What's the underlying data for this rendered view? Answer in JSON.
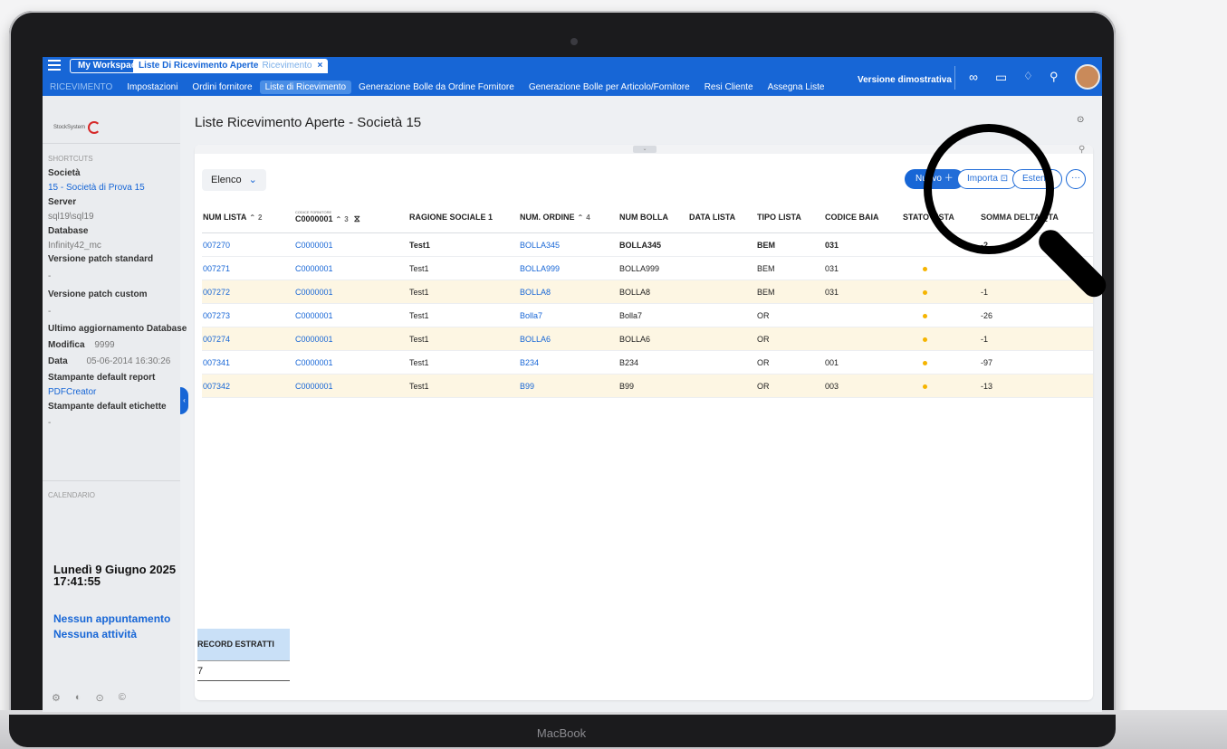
{
  "device": {
    "brand": "MacBook"
  },
  "topbar": {
    "workspace_label": "My Workspace",
    "open_tab": {
      "label": "Liste Di Ricevimento Aperte",
      "sub": "Ricevimento",
      "close": "×"
    },
    "nav": [
      {
        "label": "RICEVIMENTO",
        "state": "muted"
      },
      {
        "label": "Impostazioni",
        "state": "normal"
      },
      {
        "label": "Ordini fornitore",
        "state": "normal"
      },
      {
        "label": "Liste di Ricevimento",
        "state": "active"
      },
      {
        "label": "Generazione Bolle da Ordine Fornitore",
        "state": "normal"
      },
      {
        "label": "Generazione Bolle per Articolo/Fornitore",
        "state": "normal"
      },
      {
        "label": "Resi Cliente",
        "state": "normal"
      },
      {
        "label": "Assegna Liste",
        "state": "normal"
      }
    ],
    "version_label": "Versione dimostrativa",
    "icons": [
      "infinity-icon",
      "monitor-icon",
      "bell-icon",
      "search-icon",
      "user-avatar"
    ]
  },
  "sidebar": {
    "logo_text": "StockSystem",
    "shortcuts_title": "SHORTCUTS",
    "societa_label": "Società",
    "societa_value": "15 - Società di Prova 15",
    "server_label": "Server",
    "server_value": "sql19\\sql19",
    "database_label": "Database",
    "database_value": "Infinity42_mc",
    "patch_std_label": "Versione patch standard",
    "patch_std_value": "-",
    "patch_custom_label": "Versione patch custom",
    "patch_custom_value": "-",
    "last_update_label": "Ultimo aggiornamento Database",
    "modifica_label": "Modifica",
    "modifica_value": "9999",
    "data_label": "Data",
    "data_value": "05-06-2014 16:30:26",
    "printer_report_label": "Stampante default report",
    "printer_report_value": "PDFCreator",
    "printer_label_label": "Stampante default etichette",
    "printer_label_value": "-",
    "calendar_title": "CALENDARIO",
    "calendar_date": "Lunedì 9 Giugno 2025",
    "calendar_time": "17:41:55",
    "no_appointments": "Nessun appuntamento",
    "no_activities": "Nessuna attività"
  },
  "main": {
    "title": "Liste Ricevimento Aperte - Società 15",
    "help_icon": "?",
    "view_select": "Elenco",
    "btn_new": "Nuovo",
    "btn_import": "Importa",
    "btn_extend": "Estendi",
    "btn_more": "···",
    "columns": {
      "num_lista": "NUM LISTA",
      "num_lista_sort": "2",
      "codice_fornitore_small": "CODICE FORNITORE",
      "codice_fornitore_filter": "C0000001",
      "codice_fornitore_sort": "3",
      "ragione_sociale": "RAGIONE SOCIALE 1",
      "num_ordine": "NUM. ORDINE",
      "num_ordine_sort": "4",
      "num_bolla": "NUM BOLLA",
      "data_lista": "DATA LISTA",
      "tipo_lista": "TIPO LISTA",
      "codice_baia": "CODICE BAIA",
      "stato_lista": "STATO LISTA",
      "somma_delta": "SOMMA DELTA QTA"
    },
    "rows": [
      {
        "num_lista": "007270",
        "fornitore": "C0000001",
        "ragione": "Test1",
        "ordine": "BOLLA345",
        "bolla": "BOLLA345",
        "data": "",
        "tipo": "BEM",
        "baia": "031",
        "stato": "",
        "delta": "-2",
        "bold": true,
        "stripe": false
      },
      {
        "num_lista": "007271",
        "fornitore": "C0000001",
        "ragione": "Test1",
        "ordine": "BOLLA999",
        "bolla": "BOLLA999",
        "data": "",
        "tipo": "BEM",
        "baia": "031",
        "stato": "dot",
        "delta": "",
        "bold": false,
        "stripe": false
      },
      {
        "num_lista": "007272",
        "fornitore": "C0000001",
        "ragione": "Test1",
        "ordine": "BOLLA8",
        "bolla": "BOLLA8",
        "data": "",
        "tipo": "BEM",
        "baia": "031",
        "stato": "dot",
        "delta": "-1",
        "bold": false,
        "stripe": true
      },
      {
        "num_lista": "007273",
        "fornitore": "C0000001",
        "ragione": "Test1",
        "ordine": "Bolla7",
        "bolla": "Bolla7",
        "data": "",
        "tipo": "OR",
        "baia": "",
        "stato": "dot",
        "delta": "-26",
        "bold": false,
        "stripe": false
      },
      {
        "num_lista": "007274",
        "fornitore": "C0000001",
        "ragione": "Test1",
        "ordine": "BOLLA6",
        "bolla": "BOLLA6",
        "data": "",
        "tipo": "OR",
        "baia": "",
        "stato": "dot",
        "delta": "-1",
        "bold": false,
        "stripe": true
      },
      {
        "num_lista": "007341",
        "fornitore": "C0000001",
        "ragione": "Test1",
        "ordine": "B234",
        "bolla": "B234",
        "data": "",
        "tipo": "OR",
        "baia": "001",
        "stato": "dot",
        "delta": "-97",
        "bold": false,
        "stripe": false
      },
      {
        "num_lista": "007342",
        "fornitore": "C0000001",
        "ragione": "Test1",
        "ordine": "B99",
        "bolla": "B99",
        "data": "",
        "tipo": "OR",
        "baia": "003",
        "stato": "dot",
        "delta": "-13",
        "bold": false,
        "stripe": true
      }
    ],
    "record_label": "RECORD ESTRATTI",
    "record_value": "7"
  },
  "colors": {
    "brand_blue": "#1766d6",
    "stripe": "#fdf6e3",
    "status_dot": "#f5b400"
  }
}
